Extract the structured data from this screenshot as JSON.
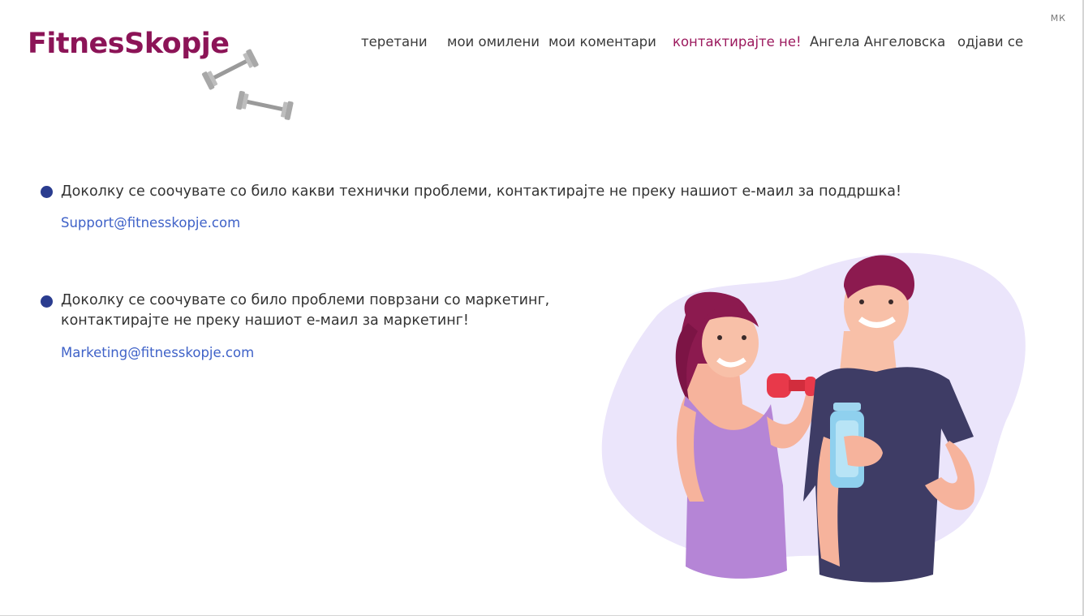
{
  "brand": {
    "logo_text": "FitnesSkopje",
    "logo_color": "#8c1457"
  },
  "language": "МК",
  "nav": {
    "items": [
      {
        "label": "теретани",
        "active": false
      },
      {
        "label": "мои омилени",
        "active": false
      },
      {
        "label": "мои коментари",
        "active": false
      },
      {
        "label": "контактирајте не!",
        "active": true
      },
      {
        "label": "Ангела Ангеловска",
        "active": false
      },
      {
        "label": "одјави се",
        "active": false
      }
    ]
  },
  "contact": {
    "support": {
      "text": "Доколку се соочувате со било какви технички проблеми, контактирајте не преку нашиот е-маил за поддршка!",
      "email": "Support@fitnesskopje.com"
    },
    "marketing": {
      "text_line1": "Доколку се соочувате со било проблеми поврзани со маркетинг,",
      "text_line2": "контактирајте не преку нашиот е-маил за маркетинг!",
      "email": "Marketing@fitnesskopje.com"
    }
  },
  "colors": {
    "active_nav": "#9c1a5e",
    "bullet": "#2a3c8f",
    "link": "#3f62c8",
    "blob": "#ebe5fb"
  },
  "icons": [
    "dumbbell-icon",
    "fitness-couple-illustration"
  ]
}
